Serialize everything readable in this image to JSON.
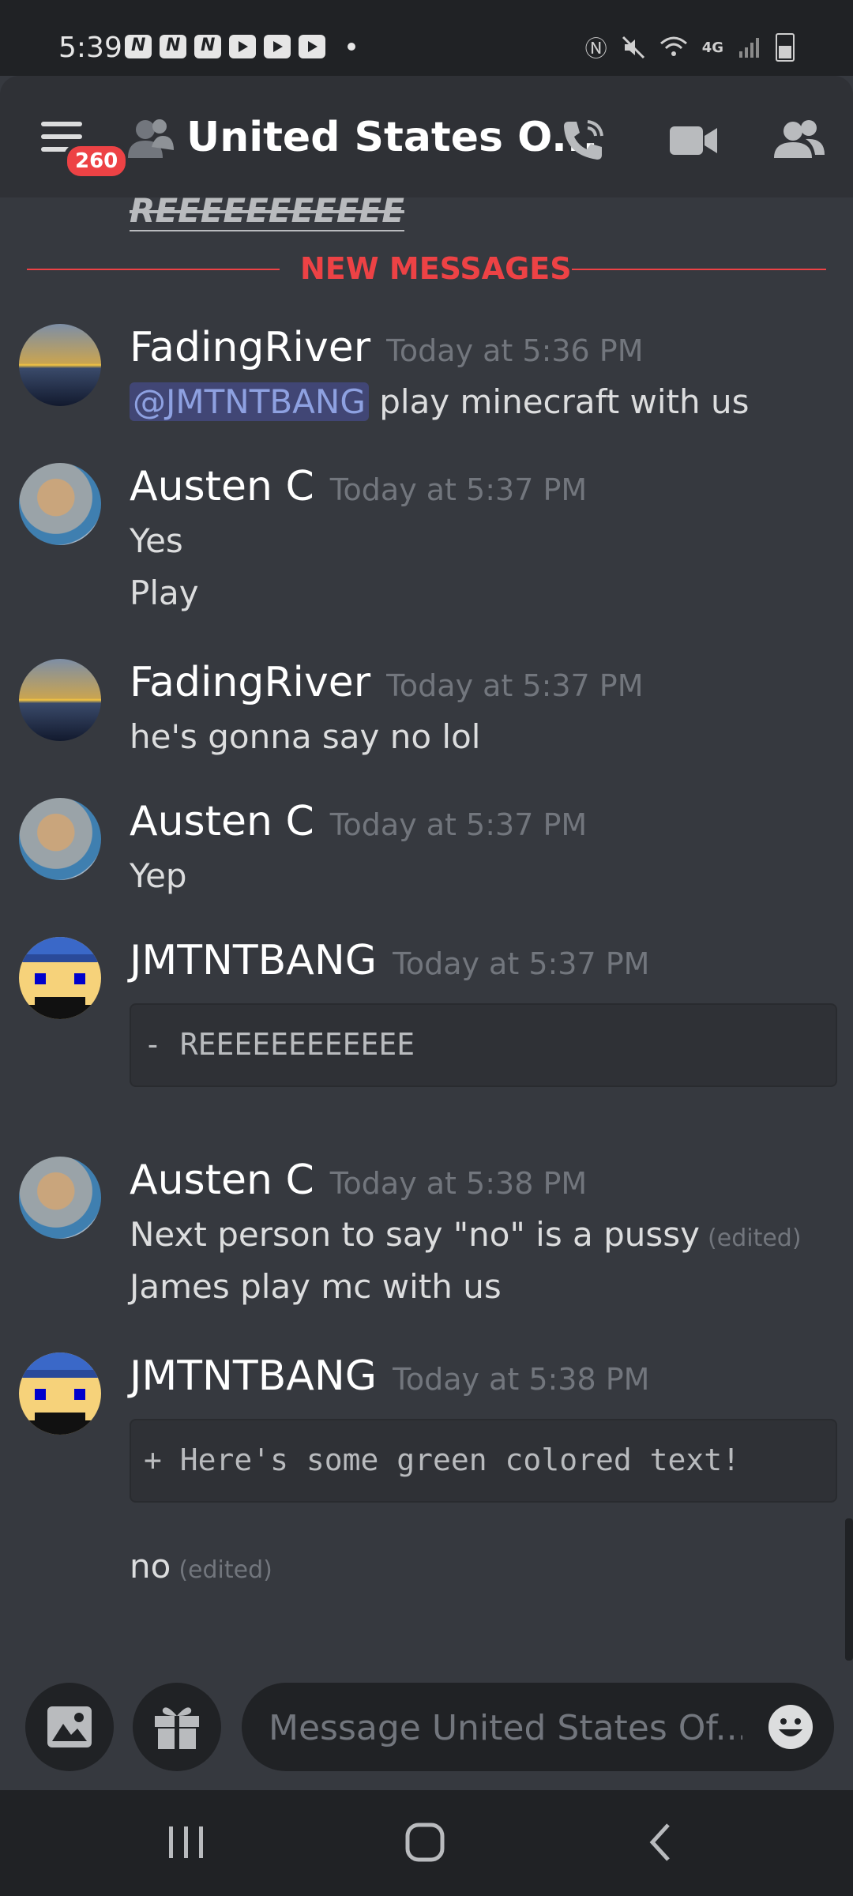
{
  "status_bar": {
    "time": "5:39",
    "notification_icons": [
      "n-app-icon",
      "n-app-icon",
      "n-app-icon",
      "youtube-icon",
      "youtube-icon",
      "youtube-icon"
    ],
    "system_icons": [
      "nfc-icon",
      "mute-icon",
      "wifi-icon",
      "4g-lte-icon",
      "signal-icon",
      "battery-icon"
    ]
  },
  "header": {
    "unread_badge": "260",
    "channel_title": "United States O...",
    "actions": [
      "call-icon",
      "video-icon",
      "members-icon"
    ]
  },
  "messages": {
    "previous_text": "REEEEEEEEEEE",
    "new_messages_label": "NEW MESSAGES",
    "items": [
      {
        "author": "FadingRiver",
        "timestamp": "Today at 5:36 PM",
        "mention": "@JMTNTBANG",
        "text": "play minecraft with us"
      },
      {
        "author": "Austen C",
        "timestamp": "Today at 5:37 PM",
        "lines": [
          "Yes",
          "Play"
        ]
      },
      {
        "author": "FadingRiver",
        "timestamp": "Today at 5:37 PM",
        "text": "he's gonna say no lol"
      },
      {
        "author": "Austen C",
        "timestamp": "Today at 5:37 PM",
        "text": "Yep"
      },
      {
        "author": "JMTNTBANG",
        "timestamp": "Today at 5:37 PM",
        "code": "- REEEEEEEEEEEE"
      },
      {
        "author": "Austen C",
        "timestamp": "Today at 5:38 PM",
        "lines": [
          "Next person to say \"no\" is a pussy",
          "James play mc with us"
        ],
        "edited": "(edited)"
      },
      {
        "author": "JMTNTBANG",
        "timestamp": "Today at 5:38 PM",
        "code": "+ Here's some green colored text!",
        "followup": "no",
        "followup_edited": "(edited)"
      }
    ]
  },
  "composer": {
    "placeholder": "Message United States Of...",
    "buttons": [
      "image-icon",
      "gift-icon",
      "emoji-icon"
    ]
  },
  "colors": {
    "background": "#36393f",
    "header": "#2f3136",
    "accent_red": "#ed4245",
    "mention_text": "#8ea1e1"
  }
}
